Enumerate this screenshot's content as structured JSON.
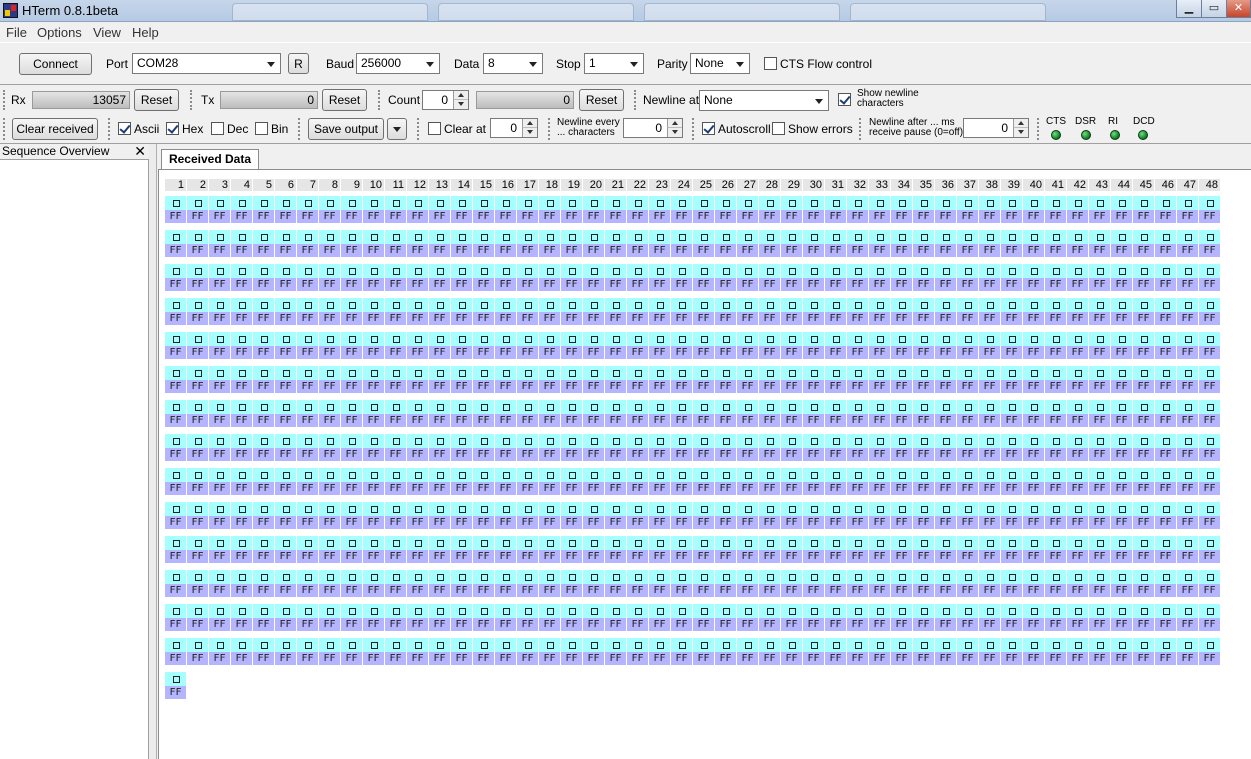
{
  "window": {
    "title": "HTerm 0.8.1beta"
  },
  "menu": [
    "File",
    "Options",
    "View",
    "Help"
  ],
  "connection": {
    "connect_label": "Connect",
    "port_label": "Port",
    "port_value": "COM28",
    "refresh_label": "R",
    "baud_label": "Baud",
    "baud_value": "256000",
    "data_label": "Data",
    "data_value": "8",
    "stop_label": "Stop",
    "stop_value": "1",
    "parity_label": "Parity",
    "parity_value": "None",
    "cts_label": "CTS Flow control",
    "cts_checked": false
  },
  "counters": {
    "rx_label": "Rx",
    "rx_value": "13057",
    "rx_reset": "Reset",
    "tx_label": "Tx",
    "tx_value": "0",
    "tx_reset": "Reset",
    "count_label": "Count",
    "count_value": "0",
    "count_field_value": "0",
    "count_reset": "Reset",
    "newline_at_label": "Newline at",
    "newline_at_value": "None",
    "show_newline_line1": "Show newline",
    "show_newline_line2": "characters",
    "show_newline_checked": true
  },
  "display": {
    "clear_received_label": "Clear received",
    "ascii_label": "Ascii",
    "ascii_checked": true,
    "hex_label": "Hex",
    "hex_checked": true,
    "dec_label": "Dec",
    "dec_checked": false,
    "bin_label": "Bin",
    "bin_checked": false,
    "save_output_label": "Save output",
    "clear_at_label": "Clear at",
    "clear_at_checked": false,
    "clear_at_value": "0",
    "newline_every_line1": "Newline every",
    "newline_every_line2": "... characters",
    "newline_every_value": "0",
    "autoscroll_label": "Autoscroll",
    "autoscroll_checked": true,
    "show_errors_label": "Show errors",
    "show_errors_checked": false,
    "newline_after_line1": "Newline after ... ms",
    "newline_after_line2": "receive pause (0=off)",
    "newline_after_value": "0",
    "signals": [
      "CTS",
      "DSR",
      "RI",
      "DCD"
    ]
  },
  "sequence_overview": {
    "title": "Sequence Overview",
    "close_glyph": "✕"
  },
  "received": {
    "tab_label": "Received Data",
    "columns": 48,
    "full_rows": 14,
    "last_row_count": 1,
    "byte_hex": "FF",
    "ascii_color": "#a6ffff",
    "hex_color": "#b4b4ff"
  }
}
